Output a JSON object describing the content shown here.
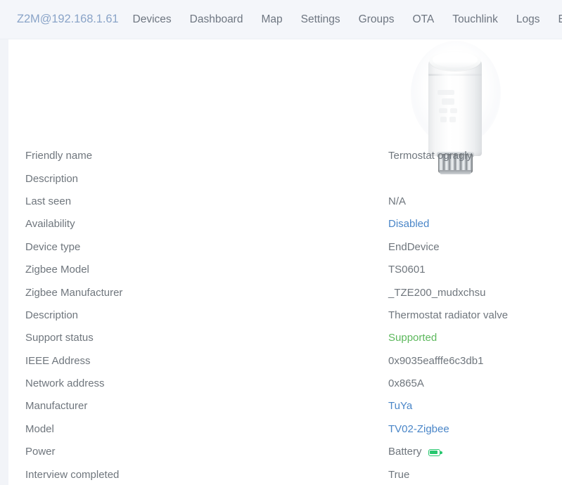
{
  "navbar": {
    "brand": "Z2M@192.168.1.61",
    "links": [
      {
        "label": "Devices"
      },
      {
        "label": "Dashboard"
      },
      {
        "label": "Map"
      },
      {
        "label": "Settings"
      },
      {
        "label": "Groups"
      },
      {
        "label": "OTA"
      },
      {
        "label": "Touchlink"
      },
      {
        "label": "Logs"
      },
      {
        "label": "Extensions"
      }
    ],
    "flag_icon": "uk-flag-icon",
    "brand_color": "#8aa4c8",
    "link_color": "#6e7681",
    "background": "#f4f6fa"
  },
  "device_image": {
    "alt": "thermostat-radiator-valve"
  },
  "colors": {
    "link": "#4a86c8",
    "supported": "#5cb85c",
    "battery": "#28c76f",
    "text": "#6f767d"
  },
  "info": {
    "rows": [
      {
        "label": "Friendly name",
        "value": "Termostat ogragly",
        "style": "plain"
      },
      {
        "label": "Description",
        "value": "",
        "style": "plain"
      },
      {
        "label": "Last seen",
        "value": "N/A",
        "style": "plain"
      },
      {
        "label": "Availability",
        "value": "Disabled",
        "style": "link"
      },
      {
        "label": "Device type",
        "value": "EndDevice",
        "style": "plain"
      },
      {
        "label": "Zigbee Model",
        "value": "TS0601",
        "style": "plain"
      },
      {
        "label": "Zigbee Manufacturer",
        "value": "_TZE200_mudxchsu",
        "style": "plain"
      },
      {
        "label": "Description",
        "value": "Thermostat radiator valve",
        "style": "plain"
      },
      {
        "label": "Support status",
        "value": "Supported",
        "style": "ok"
      },
      {
        "label": "IEEE Address",
        "value": "0x9035eafffe6c3db1",
        "style": "plain"
      },
      {
        "label": "Network address",
        "value": "0x865A",
        "style": "plain"
      },
      {
        "label": "Manufacturer",
        "value": "TuYa",
        "style": "link"
      },
      {
        "label": "Model",
        "value": "TV02-Zigbee",
        "style": "link"
      },
      {
        "label": "Power",
        "value": "Battery",
        "style": "plain",
        "icon": "battery-full-icon"
      },
      {
        "label": "Interview completed",
        "value": "True",
        "style": "plain"
      }
    ]
  }
}
